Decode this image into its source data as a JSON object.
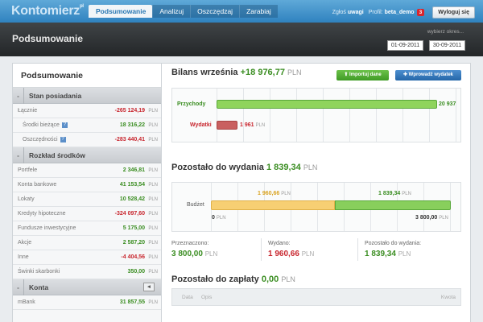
{
  "app": {
    "logo": "Kontomierz",
    "logo_sup": "pl"
  },
  "nav": {
    "tabs": [
      "Podsumowanie",
      "Analizuj",
      "Oszczędzaj",
      "Zarabiaj"
    ],
    "active": 0
  },
  "topright": {
    "report": "Zgłoś",
    "report_b": "uwagi",
    "profile": "Profil:",
    "profile_name": "beta_demo",
    "badge": "3",
    "logout": "Wyloguj się"
  },
  "header": {
    "title": "Podsumowanie",
    "period_label": "wybierz okres...",
    "date_from": "01-09-2011",
    "date_to": "30-09-2011"
  },
  "sidebar": {
    "title": "Podsumowanie",
    "currency": "PLN",
    "sections": {
      "stan": {
        "label": "Stan posiadania",
        "toggle": "-"
      },
      "rozklad": {
        "label": "Rozkład środków",
        "toggle": "-"
      },
      "konta": {
        "label": "Konta",
        "toggle": "-",
        "arrow": "◂"
      }
    },
    "stan_rows": [
      {
        "label": "Łącznie",
        "value": "-265 124,19",
        "color": "red"
      },
      {
        "label": "Środki bieżące",
        "value": "18 316,22",
        "color": "green"
      },
      {
        "label": "Oszczędności",
        "value": "-283 440,41",
        "color": "red"
      }
    ],
    "rozklad_rows": [
      {
        "label": "Portfele",
        "value": "2 346,81",
        "color": "green"
      },
      {
        "label": "Konta bankowe",
        "value": "41 153,54",
        "color": "green"
      },
      {
        "label": "Lokaty",
        "value": "10 528,42",
        "color": "green"
      },
      {
        "label": "Kredyty hipoteczne",
        "value": "-324 097,60",
        "color": "red"
      },
      {
        "label": "Fundusze inwestycyjne",
        "value": "5 175,00",
        "color": "green"
      },
      {
        "label": "Akcje",
        "value": "2 587,20",
        "color": "green"
      },
      {
        "label": "Inne",
        "value": "-4 404,56",
        "color": "red"
      },
      {
        "label": "Świnki skarbonki",
        "value": "350,00",
        "color": "green"
      }
    ],
    "konta_rows": [
      {
        "label": "mBank",
        "value": "31 857,55",
        "color": "green"
      }
    ]
  },
  "bilans": {
    "title": "Bilans września",
    "value": "+18 976,77",
    "unit": "PLN",
    "import_btn": "Importuj dane",
    "add_btn": "Wprowadź wydatek",
    "income_label": "Przychody",
    "income_value": "20 937",
    "expense_label": "Wydatki",
    "expense_value": "1 961"
  },
  "pozostalo": {
    "title": "Pozostało do wydania",
    "value": "1 839,34",
    "unit": "PLN",
    "row_label": "Budżet",
    "spent_value": "1 960,66",
    "remaining_value": "1 839,34",
    "axis_start": "0",
    "axis_end": "3 800,00",
    "spent_fraction": 0.516
  },
  "stats": {
    "przeznaczono_label": "Przeznaczono:",
    "przeznaczono_value": "3 800,00",
    "wydano_label": "Wydano:",
    "wydano_value": "1 960,66",
    "pozostalo_label": "Pozostało do wydania:",
    "pozostalo_value": "1 839,34"
  },
  "zaplaty": {
    "title": "Pozostało do zapłaty",
    "value": "0,00",
    "unit": "PLN",
    "columns": [
      "Data",
      "Opis",
      "Kwota"
    ]
  },
  "colors": {
    "income_bar": "#8fd45c",
    "expense_bar": "#c96060",
    "spent_bar": "#f7cf73",
    "remaining_bar": "#88cf5c"
  }
}
